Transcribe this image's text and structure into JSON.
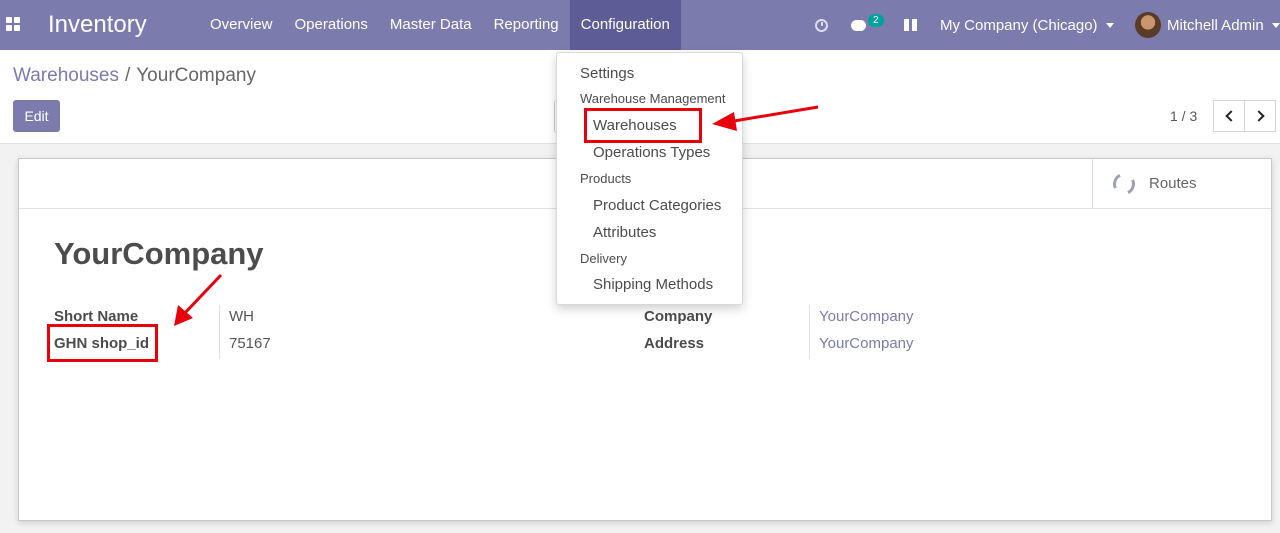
{
  "navbar": {
    "app_title": "Inventory",
    "menu": [
      {
        "label": "Overview"
      },
      {
        "label": "Operations"
      },
      {
        "label": "Master Data"
      },
      {
        "label": "Reporting"
      },
      {
        "label": "Configuration"
      }
    ],
    "chat_count": "2",
    "company_switcher": "My Company (Chicago)",
    "user_name": "Mitchell Admin",
    "color": "#7c7bad"
  },
  "breadcrumb": {
    "parent": "Warehouses",
    "separator": "/",
    "current": "YourCompany"
  },
  "controls": {
    "edit_label": "Edit",
    "pager": "1 / 3"
  },
  "dropdown": {
    "settings": "Settings",
    "section_warehouse": "Warehouse Management",
    "warehouses": "Warehouses",
    "operations_types": "Operations Types",
    "section_products": "Products",
    "product_categories": "Product Categories",
    "attributes": "Attributes",
    "section_delivery": "Delivery",
    "shipping_methods": "Shipping Methods"
  },
  "form": {
    "routes_label": "Routes",
    "title": "YourCompany",
    "short_name_label": "Short Name",
    "short_name_value": "WH",
    "ghn_label": "GHN shop_id",
    "ghn_value": "75167",
    "company_label": "Company",
    "company_value": "YourCompany",
    "address_label": "Address",
    "address_value": "YourCompany"
  },
  "annotation_color": "#e8000b"
}
